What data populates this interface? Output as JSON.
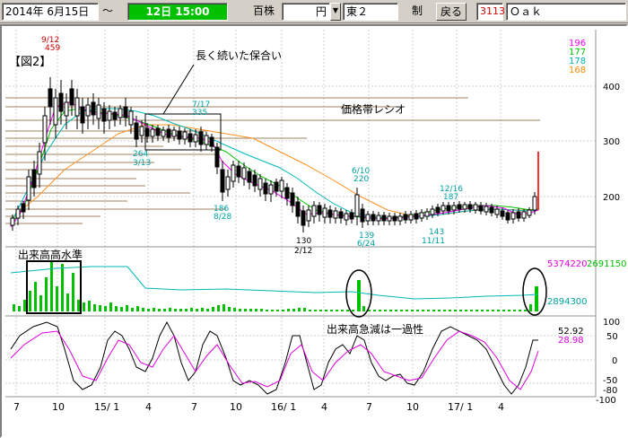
{
  "toolbar": {
    "period_start": "2014年  6月15日",
    "tilde": "～",
    "period_time": "12日  15:00",
    "unit_label": "百株",
    "currency_value": "円",
    "market_value": "東２",
    "control_label": "制",
    "back_button": "戻る",
    "stock_code": "3113",
    "stock_name": "Ｏａｋ"
  },
  "chart": {
    "figure_label": "【図2】",
    "note_plateau": "長く続いた保合い",
    "note_price_band": "価格帯レシオ",
    "note_volume": "出来高高水準",
    "note_volume_drop": "出来高急減は一過性",
    "ma_values": [
      {
        "value": "196",
        "color": "#ff00ff"
      },
      {
        "value": "177",
        "color": "#00c000"
      },
      {
        "value": "178",
        "color": "#00b0b0"
      },
      {
        "value": "168",
        "color": "#ff8c00"
      }
    ],
    "price_axis": [
      "400",
      "300",
      "200"
    ],
    "volume_labels": {
      "max": "5374220",
      "right": "2691150",
      "mid": "2894300"
    },
    "osc_labels": {
      "v1": "52.92",
      "v2": "28.98"
    },
    "osc_axis": [
      "100",
      "50",
      "0",
      "-50",
      "-80",
      "-100"
    ],
    "x_axis": [
      "7",
      "10",
      "15/ 1",
      "4",
      "7",
      "10",
      "16/ 1",
      "4",
      "7",
      "10",
      "17/ 1",
      "4"
    ],
    "annotations": [
      {
        "id": "a1",
        "line1": "9/12",
        "line2": "459",
        "color": "#d00000"
      },
      {
        "id": "a2",
        "line1": "7/17",
        "line2": "335",
        "color": "#00a0a0"
      },
      {
        "id": "a3",
        "line1": "264",
        "line2": "3/13",
        "color": "#00a0a0"
      },
      {
        "id": "a4",
        "line1": "186",
        "line2": "8/28",
        "color": "#00a0a0"
      },
      {
        "id": "a5",
        "line1": "130",
        "line2": "2/12",
        "color": "#000000"
      },
      {
        "id": "a6",
        "line1": "6/10",
        "line2": "220",
        "color": "#00a0a0"
      },
      {
        "id": "a7",
        "line1": "139",
        "line2": "6/24",
        "color": "#00a0a0"
      },
      {
        "id": "a8",
        "line1": "12/16",
        "line2": "187",
        "color": "#00a0a0"
      },
      {
        "id": "a9",
        "line1": "143",
        "line2": "11/11",
        "color": "#00a0a0"
      }
    ]
  }
}
